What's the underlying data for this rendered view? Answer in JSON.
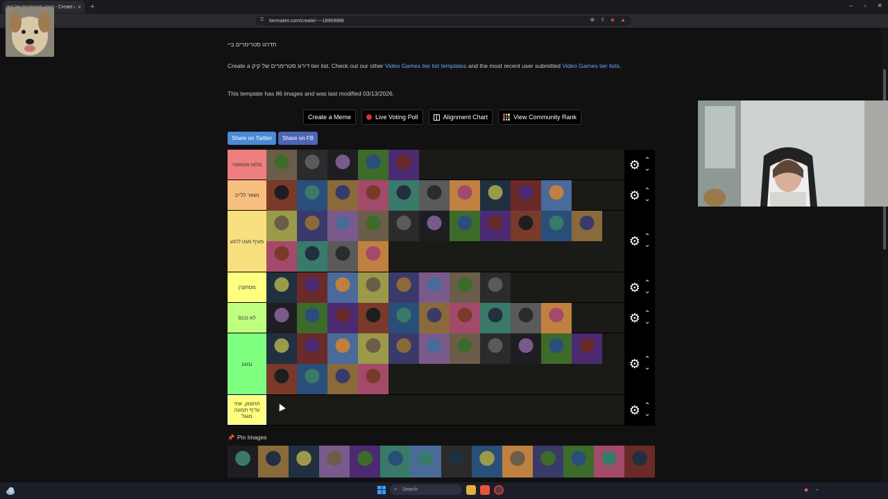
{
  "browser": {
    "tab_title": "דירוג סטרימרים של קיק - Create a",
    "url": "tiermaker.com/create/----18969988"
  },
  "page": {
    "title_text": "תדרגו סטרימרים ביי",
    "desc_prefix": "Create a",
    "desc_name": "דירוג סטרימרים של קיק",
    "desc_mid": "tier list. Check out our other",
    "link1": "Video Games tier list templates",
    "desc_mid2": "and the most recent user submitted",
    "link2": "Video Games tier lists",
    "desc_end": ".",
    "template_info": "This template has 86 images and was last modified 03/13/2026.",
    "buttons": {
      "meme": "Create a Meme",
      "poll": "Live Voting Poll",
      "alignment": "Alignment Chart",
      "community": "View Community Rank"
    },
    "share_twitter": "Share on Twitter",
    "share_fb": "Share on FB",
    "pin_images": "Pin Images"
  },
  "tiers": [
    {
      "label": "מלאו אוטופטי",
      "color": "#ef7f7f",
      "image_count": 5
    },
    {
      "label": "נשאר ללייב",
      "color": "#f7bf7f",
      "image_count": 10
    },
    {
      "label": "מעיף מגט לרגע",
      "color": "#f8df7f",
      "image_count": 15
    },
    {
      "label": "מסתקרן",
      "color": "#fefe7f",
      "image_count": 8
    },
    {
      "label": "לא נכנס",
      "color": "#bfff7f",
      "image_count": 10
    },
    {
      "label": "נמגע",
      "color": "#7fff7f",
      "image_count": 15
    },
    {
      "label": "תחמוק, אתי עדיף תמונה מגגל",
      "color": "#ffff7f",
      "image_count": 0
    }
  ],
  "pool_count": 14,
  "taskbar": {
    "search_placeholder": "Search"
  },
  "icons": [
    "gear-icon",
    "chevron-up-icon",
    "chevron-down-icon",
    "pin-icon",
    "bookmark-icon",
    "lock-icon",
    "windows-icon",
    "search-icon"
  ]
}
